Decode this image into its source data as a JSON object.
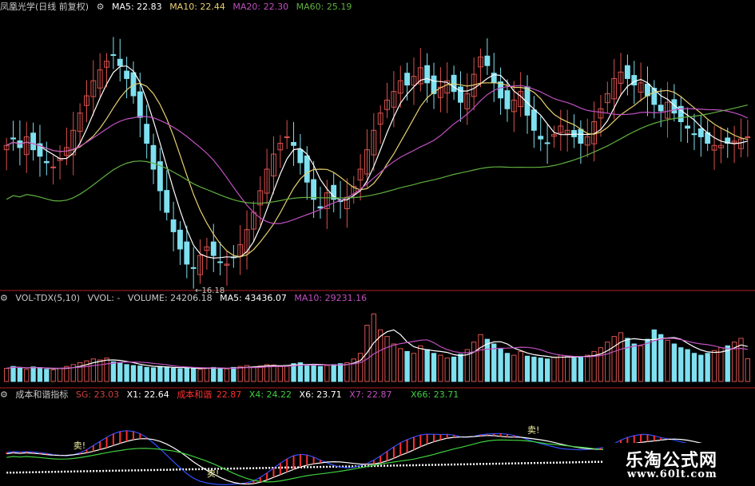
{
  "header_main": {
    "title": "凤凰光学(日线 前复权)",
    "ma5": "MA5: 22.83",
    "ma10": "MA10: 22.44",
    "ma20": "MA20: 22.30",
    "ma60": "MA60: 25.19"
  },
  "header_vol": {
    "title": "VOL-TDX(5,10)",
    "vvol": "VVOL: -",
    "volume": "VOLUME: 24206.18",
    "ma5": "MA5: 43436.07",
    "ma10": "MA10: 29231.16"
  },
  "header_ind": {
    "title": "成本和谐指标",
    "sg": "SG: 23.03",
    "x1": "X1: 22.64",
    "name": "成本和谐",
    "name_val": "22.87",
    "x4": "X4: 24.22",
    "x6": "X6: 23.71",
    "x7": "X7: 22.87",
    "x66": "X66: 23.71"
  },
  "annotations": {
    "low_price": "←16.18",
    "sell_1": "卖!",
    "sell_2": "卖!",
    "sell_3": "卖!"
  },
  "watermark": {
    "line1": "乐淘公式网",
    "line2": "www.60lt.com"
  },
  "colors": {
    "up": "#d9534f",
    "down": "#7fe0f0",
    "ma5": "#ffffff",
    "ma10": "#e8d070",
    "ma20": "#c050c0",
    "ma60": "#60b040",
    "separator": "#b02020"
  },
  "chart_data": [
    {
      "type": "candlestick",
      "title": "凤凰光学(日线 前复权)",
      "y_range": [
        16,
        28.5
      ],
      "series_names": [
        "MA5",
        "MA10",
        "MA20",
        "MA60"
      ],
      "close": [
        22.5,
        22.8,
        22.4,
        22.9,
        22.3,
        22.0,
        21.7,
        21.5,
        21.9,
        22.4,
        23.2,
        24.0,
        24.8,
        25.5,
        26.0,
        26.4,
        26.7,
        26.2,
        25.6,
        24.8,
        23.8,
        22.6,
        21.4,
        20.4,
        19.4,
        18.5,
        17.7,
        17.0,
        16.8,
        17.4,
        17.8,
        17.4,
        17.1,
        17.0,
        17.3,
        17.9,
        18.6,
        19.4,
        20.4,
        21.4,
        22.1,
        22.6,
        22.9,
        22.5,
        21.7,
        20.8,
        20.0,
        19.6,
        20.3,
        20.0,
        19.9,
        20.1,
        20.6,
        21.4,
        22.3,
        23.2,
        24.0,
        24.6,
        25.0,
        25.5,
        25.3,
        25.7,
        26.1,
        25.4,
        24.9,
        25.2,
        25.5,
        25.0,
        24.5,
        24.9,
        25.8,
        26.6,
        26.2,
        25.4,
        24.7,
        24.2,
        24.6,
        25.0,
        23.9,
        23.2,
        22.8,
        22.6,
        23.0,
        23.4,
        23.2,
        22.9,
        22.6,
        22.9,
        23.6,
        24.2,
        24.9,
        25.6,
        25.9,
        25.6,
        25.3,
        25.4,
        24.8,
        24.4,
        24.1,
        24.5,
        24.0,
        23.6,
        23.3,
        23.0,
        22.9,
        22.6,
        22.5,
        22.5,
        22.6,
        22.7,
        22.8,
        22.9
      ],
      "volume": [
        14000,
        16000,
        15000,
        13000,
        15500,
        14500,
        13000,
        12500,
        14000,
        16000,
        18000,
        20000,
        22000,
        24000,
        23000,
        25000,
        21000,
        19500,
        18000,
        17000,
        16500,
        15000,
        14500,
        16000,
        15500,
        14000,
        13500,
        15000,
        14000,
        13000,
        14500,
        15000,
        14000,
        13500,
        15000,
        16000,
        17000,
        15500,
        16500,
        18000,
        17500,
        16000,
        17000,
        19000,
        20000,
        18000,
        17500,
        16000,
        17000,
        18000,
        19000,
        20000,
        24000,
        30000,
        60000,
        72000,
        55000,
        48000,
        40000,
        35000,
        32000,
        30000,
        38000,
        34000,
        30000,
        28000,
        25000,
        26000,
        29000,
        34000,
        42000,
        50000,
        45000,
        40000,
        35000,
        30000,
        28000,
        32000,
        27000,
        26000,
        25000,
        24000,
        26000,
        28000,
        27000,
        25000,
        26000,
        28000,
        32000,
        36000,
        42000,
        48000,
        52000,
        46000,
        40000,
        38000,
        45000,
        55000,
        50000,
        44000,
        40000,
        36000,
        34000,
        30000,
        28000,
        30000,
        33000,
        36000,
        38000,
        42000,
        46000,
        24206
      ],
      "volume_ma5": 43436.07,
      "volume_ma10": 29231.16,
      "min_label": 16.18
    },
    {
      "type": "line",
      "title": "成本和谐指标",
      "series_names": [
        "SG",
        "X1",
        "成本和谐",
        "X4",
        "X6",
        "X7",
        "X66"
      ],
      "values": {
        "SG": 23.03,
        "X1": 22.64,
        "成本和谐": 22.87,
        "X4": 24.22,
        "X6": 23.71,
        "X7": 22.87,
        "X66": 23.71
      }
    }
  ]
}
